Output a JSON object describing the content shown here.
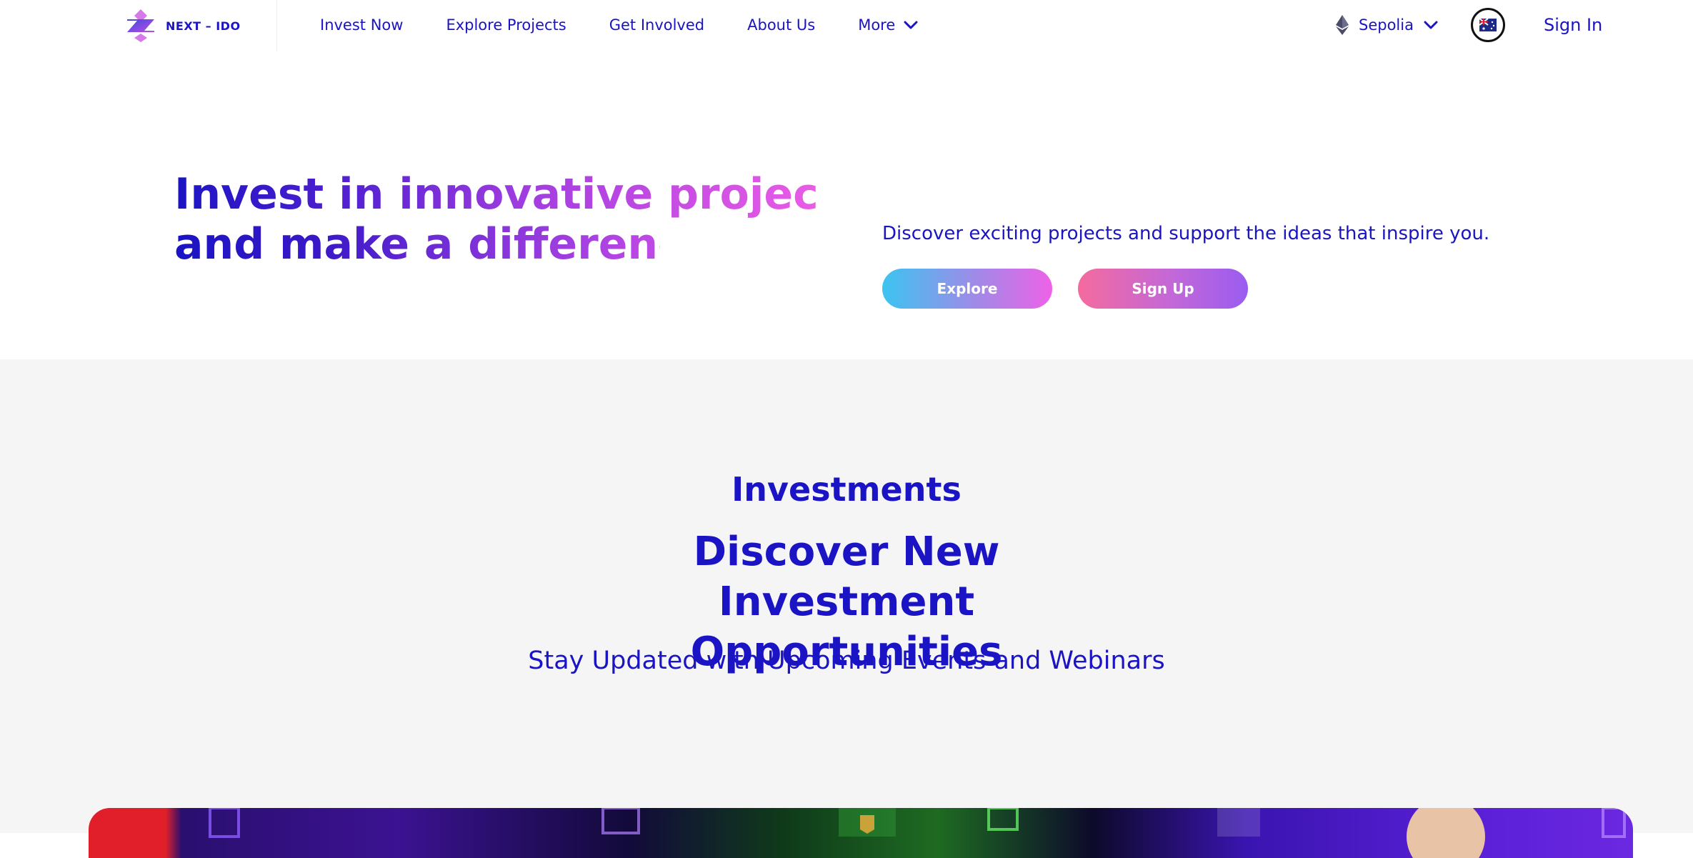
{
  "brand": {
    "name": "NEXT – IDO"
  },
  "nav": {
    "items": [
      {
        "label": "Invest Now"
      },
      {
        "label": "Explore Projects"
      },
      {
        "label": "Get Involved"
      },
      {
        "label": "About Us"
      },
      {
        "label": "More"
      }
    ]
  },
  "network": {
    "label": "Sepolia",
    "icon": "ethereum-icon"
  },
  "language": {
    "icon": "australia-flag-icon"
  },
  "auth": {
    "signin_label": "Sign In"
  },
  "hero": {
    "title_line1": "Invest in innovative projects",
    "title_line2": "and make a difference",
    "description": "Discover exciting projects and support the ideas that inspire you.",
    "explore_label": "Explore",
    "signup_label": "Sign Up"
  },
  "investments": {
    "label": "Investments",
    "title_line1": "Discover New Investment",
    "title_line2": "Opportunities",
    "subtitle": "Stay Updated with Upcoming Events and Webinars"
  },
  "colors": {
    "primary": "#1a14c4",
    "accent_pink": "#ea5ce6",
    "accent_cyan": "#3cc4f0",
    "section_bg": "#f5f5f5"
  }
}
